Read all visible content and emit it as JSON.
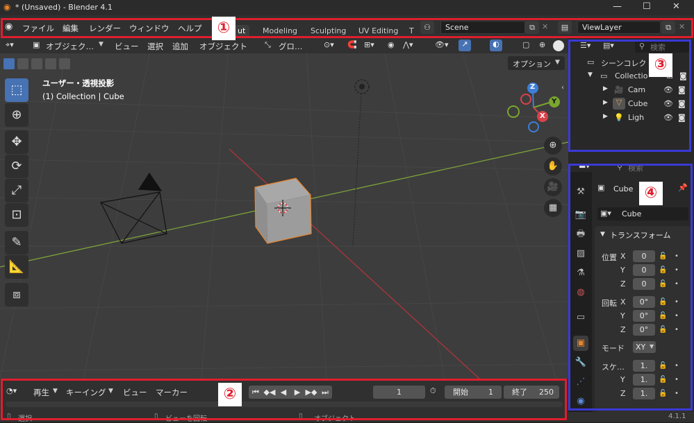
{
  "window": {
    "title": "* (Unsaved) - Blender 4.1",
    "minimize": "—",
    "maximize": "☐",
    "close": "✕"
  },
  "menu": [
    "ファイル",
    "編集",
    "レンダー",
    "ウィンドウ",
    "ヘルプ"
  ],
  "workspaces": [
    "Layout",
    "Modeling",
    "Sculpting",
    "UV Editing",
    "T"
  ],
  "workspace_active_visible": "ut",
  "scene": {
    "name": "Scene",
    "viewlayer": "ViewLayer"
  },
  "viewport": {
    "mode": "オブジェク…",
    "menus": [
      "ビュー",
      "選択",
      "追加",
      "オブジェクト"
    ],
    "transform_orientation": "グロ…",
    "view_name": "ユーザー・透視投影",
    "collection_info": "(1) Collection | Cube",
    "options": "オプション"
  },
  "gizmo": {
    "z": "Z",
    "y": "Y",
    "x": "X"
  },
  "timeline": {
    "playback": "再生",
    "keying": "キーイング",
    "view": "ビュー",
    "marker": "マーカー",
    "current_frame": "1",
    "start_label": "開始",
    "start": "1",
    "end_label": "終了",
    "end": "250"
  },
  "statusbar": {
    "select": "選択",
    "rotate": "ビューを回転",
    "object": "オブジェクト",
    "version": "4.1.1"
  },
  "outliner": {
    "search_placeholder": "検索",
    "scene_collection": "シーンコレク",
    "items": [
      {
        "name": "Collectio",
        "icon": "collection-icon"
      },
      {
        "name": "Cam",
        "icon": "camera-icon"
      },
      {
        "name": "Cube",
        "icon": "mesh-icon"
      },
      {
        "name": "Ligh",
        "icon": "light-icon"
      }
    ]
  },
  "properties": {
    "search_placeholder": "検索",
    "object_name": "Cube",
    "data_name": "Cube",
    "panel_title": "トランスフォーム",
    "location_label": "位置",
    "rotation_label": "回転",
    "mode_label": "モード",
    "mode_value": "XY",
    "scale_label": "スケ…",
    "axis_x": "X",
    "axis_y": "Y",
    "axis_z": "Z",
    "location": [
      "0",
      "0",
      "0"
    ],
    "rotation": [
      "0°",
      "0°",
      "0°"
    ],
    "scale": [
      "1.",
      "1.",
      "1."
    ]
  },
  "annotations": [
    "①",
    "②",
    "③",
    "④"
  ],
  "colors": {
    "annotation_red": "#e01e2d",
    "annotation_blue": "#3a3ad6",
    "accent_blue": "#4772b3",
    "active_orange": "#e8842b"
  }
}
